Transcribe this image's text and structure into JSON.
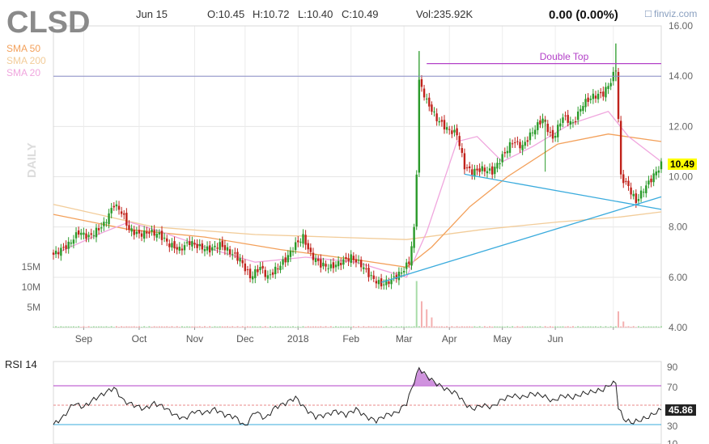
{
  "header": {
    "ticker": "CLSD",
    "date": "Jun 15",
    "open": "O:10.45",
    "high": "H:10.72",
    "low": "L:10.40",
    "close": "C:10.49",
    "volume": "Vol:235.92K",
    "change": "0.00 (0.00%)",
    "brand": "finviz.com"
  },
  "legend": {
    "sma50": "SMA 50",
    "sma200": "SMA 200",
    "sma20": "SMA 20",
    "daily": "DAILY"
  },
  "colors": {
    "candle_up": "#2a9a2a",
    "candle_down": "#c0221b",
    "sma50": "#f3a05a",
    "sma200": "#f2cc99",
    "sma20": "#f0a6de",
    "trend": "#3aabdd",
    "double_top": "#b341c8",
    "resistance": "#8a8ec8",
    "rsi_line": "#222222",
    "rsi_70": "#b341c8",
    "rsi_30": "#3aabdd",
    "rsi_50": "#e88888",
    "volume_up": "#a8dca8",
    "volume_down": "#f4b0b0",
    "price_label_bg": "#ffff00"
  },
  "annotations": {
    "double_top": "Double Top"
  },
  "rsi": {
    "label": "RSI 14",
    "value_label": "45.86",
    "ticks": [
      "90",
      "70",
      "50",
      "30",
      "10"
    ]
  },
  "chart_data": [
    {
      "type": "candlestick",
      "title": "CLSD",
      "x_labels": [
        "Sep",
        "Oct",
        "Nov",
        "Dec",
        "2018",
        "Feb",
        "Mar",
        "Apr",
        "May",
        "Jun"
      ],
      "y_ticks": [
        "16.00",
        "14.00",
        "12.00",
        "10.00",
        "8.00",
        "6.00",
        "4.00"
      ],
      "ylim": [
        4,
        16
      ],
      "volume_ticks": [
        "15M",
        "10M",
        "5M"
      ],
      "last_price_label": "10.49",
      "close_path": [
        [
          0,
          6.9
        ],
        [
          6,
          7.3
        ],
        [
          10,
          7.8
        ],
        [
          14,
          7.6
        ],
        [
          20,
          8.1
        ],
        [
          24,
          8.9
        ],
        [
          27,
          8.6
        ],
        [
          30,
          7.9
        ],
        [
          34,
          7.7
        ],
        [
          38,
          7.8
        ],
        [
          42,
          7.7
        ],
        [
          46,
          7.3
        ],
        [
          50,
          7.1
        ],
        [
          54,
          7.4
        ],
        [
          58,
          7.2
        ],
        [
          62,
          7.1
        ],
        [
          66,
          7.3
        ],
        [
          70,
          7.0
        ],
        [
          74,
          6.7
        ],
        [
          78,
          6.0
        ],
        [
          82,
          6.4
        ],
        [
          85,
          6.0
        ],
        [
          88,
          6.3
        ],
        [
          92,
          6.7
        ],
        [
          96,
          7.3
        ],
        [
          99,
          7.6
        ],
        [
          102,
          6.9
        ],
        [
          106,
          6.5
        ],
        [
          110,
          6.4
        ],
        [
          114,
          6.6
        ],
        [
          118,
          6.8
        ],
        [
          122,
          6.5
        ],
        [
          126,
          6.0
        ],
        [
          130,
          5.7
        ],
        [
          134,
          5.9
        ],
        [
          138,
          6.2
        ],
        [
          141,
          6.6
        ],
        [
          143,
          7.9
        ],
        [
          144,
          10.2
        ],
        [
          145,
          13.8
        ],
        [
          148,
          13.0
        ],
        [
          152,
          12.3
        ],
        [
          156,
          11.9
        ],
        [
          160,
          11.7
        ],
        [
          163,
          10.4
        ],
        [
          166,
          10.2
        ],
        [
          170,
          10.3
        ],
        [
          174,
          10.2
        ],
        [
          178,
          10.8
        ],
        [
          182,
          11.4
        ],
        [
          186,
          11.2
        ],
        [
          190,
          11.8
        ],
        [
          194,
          12.3
        ],
        [
          198,
          11.5
        ],
        [
          202,
          12.4
        ],
        [
          206,
          12.1
        ],
        [
          210,
          12.9
        ],
        [
          214,
          13.2
        ],
        [
          218,
          13.3
        ],
        [
          221,
          13.8
        ],
        [
          223,
          14.3
        ],
        [
          224,
          12.3
        ],
        [
          225,
          10.0
        ],
        [
          228,
          9.6
        ],
        [
          231,
          9.0
        ],
        [
          234,
          9.5
        ],
        [
          237,
          9.9
        ],
        [
          241,
          10.49
        ]
      ],
      "volume_spikes": [
        [
          144,
          2.3
        ],
        [
          146,
          1.3
        ],
        [
          148,
          0.9
        ],
        [
          150,
          0.5
        ],
        [
          224,
          0.8
        ],
        [
          226,
          0.3
        ]
      ],
      "sma20_path": [
        [
          0,
          6.9
        ],
        [
          20,
          7.8
        ],
        [
          30,
          8.2
        ],
        [
          40,
          7.9
        ],
        [
          60,
          7.2
        ],
        [
          80,
          6.6
        ],
        [
          100,
          6.8
        ],
        [
          120,
          6.6
        ],
        [
          140,
          6.0
        ],
        [
          148,
          7.8
        ],
        [
          160,
          11.4
        ],
        [
          168,
          11.6
        ],
        [
          178,
          10.6
        ],
        [
          190,
          11.2
        ],
        [
          205,
          12.1
        ],
        [
          220,
          12.6
        ],
        [
          228,
          11.6
        ],
        [
          241,
          10.6
        ]
      ],
      "sma50_path": [
        [
          0,
          8.5
        ],
        [
          30,
          7.9
        ],
        [
          60,
          7.6
        ],
        [
          90,
          7.1
        ],
        [
          120,
          6.7
        ],
        [
          140,
          6.4
        ],
        [
          150,
          7.2
        ],
        [
          165,
          8.8
        ],
        [
          180,
          10.0
        ],
        [
          200,
          11.3
        ],
        [
          220,
          11.7
        ],
        [
          241,
          11.4
        ]
      ],
      "sma200_path": [
        [
          0,
          8.9
        ],
        [
          40,
          8.0
        ],
        [
          80,
          7.7
        ],
        [
          110,
          7.6
        ],
        [
          140,
          7.5
        ],
        [
          170,
          7.9
        ],
        [
          200,
          8.2
        ],
        [
          225,
          8.4
        ],
        [
          241,
          8.6
        ]
      ],
      "trendline_up": [
        [
          130,
          5.8
        ],
        [
          241,
          9.2
        ]
      ],
      "trendline_down": [
        [
          163,
          10.1
        ],
        [
          241,
          8.7
        ]
      ],
      "double_top_line": [
        [
          148,
          14.5
        ],
        [
          241,
          14.5
        ]
      ],
      "resistance_line": [
        [
          0,
          14.0
        ],
        [
          241,
          14.0
        ]
      ],
      "rsi_path": [
        [
          0,
          30
        ],
        [
          4,
          38
        ],
        [
          8,
          52
        ],
        [
          12,
          48
        ],
        [
          16,
          56
        ],
        [
          20,
          62
        ],
        [
          24,
          68
        ],
        [
          28,
          54
        ],
        [
          32,
          50
        ],
        [
          36,
          46
        ],
        [
          40,
          52
        ],
        [
          44,
          48
        ],
        [
          48,
          40
        ],
        [
          52,
          36
        ],
        [
          56,
          44
        ],
        [
          60,
          42
        ],
        [
          64,
          46
        ],
        [
          68,
          40
        ],
        [
          72,
          38
        ],
        [
          76,
          28
        ],
        [
          80,
          44
        ],
        [
          84,
          36
        ],
        [
          88,
          48
        ],
        [
          92,
          52
        ],
        [
          96,
          58
        ],
        [
          100,
          46
        ],
        [
          104,
          38
        ],
        [
          108,
          40
        ],
        [
          112,
          44
        ],
        [
          116,
          40
        ],
        [
          120,
          46
        ],
        [
          124,
          38
        ],
        [
          128,
          34
        ],
        [
          132,
          40
        ],
        [
          136,
          42
        ],
        [
          140,
          52
        ],
        [
          143,
          74
        ],
        [
          145,
          88
        ],
        [
          148,
          80
        ],
        [
          152,
          72
        ],
        [
          156,
          66
        ],
        [
          160,
          62
        ],
        [
          163,
          52
        ],
        [
          166,
          46
        ],
        [
          170,
          50
        ],
        [
          174,
          48
        ],
        [
          178,
          56
        ],
        [
          182,
          60
        ],
        [
          186,
          58
        ],
        [
          190,
          62
        ],
        [
          194,
          60
        ],
        [
          198,
          54
        ],
        [
          202,
          60
        ],
        [
          206,
          58
        ],
        [
          210,
          62
        ],
        [
          214,
          64
        ],
        [
          218,
          66
        ],
        [
          221,
          72
        ],
        [
          223,
          73
        ],
        [
          224,
          48
        ],
        [
          226,
          36
        ],
        [
          229,
          32
        ],
        [
          232,
          34
        ],
        [
          236,
          38
        ],
        [
          241,
          45.86
        ]
      ]
    }
  ]
}
